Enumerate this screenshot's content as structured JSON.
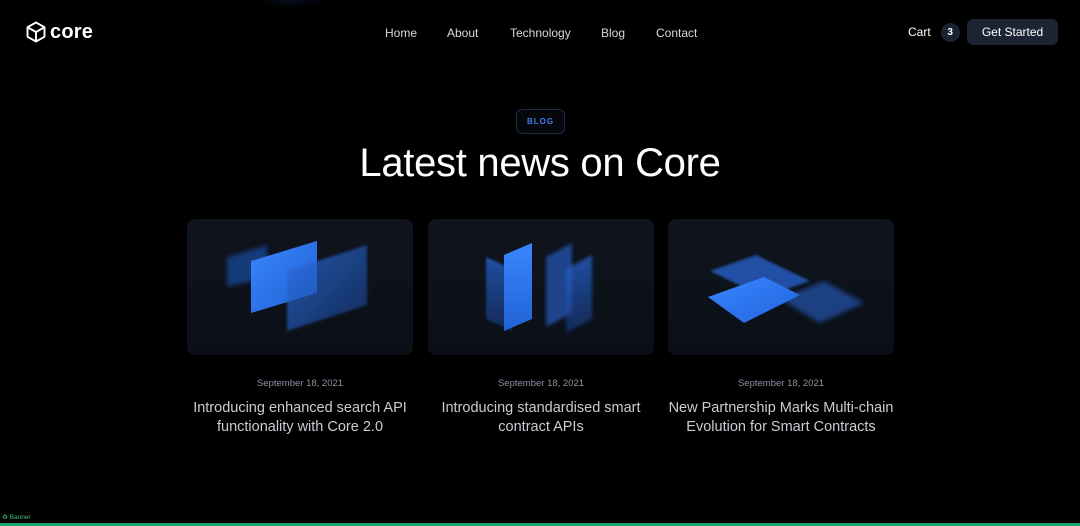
{
  "brand": {
    "name": "core",
    "logo_icon": "cube-icon"
  },
  "nav": {
    "items": [
      {
        "label": "Home"
      },
      {
        "label": "About"
      },
      {
        "label": "Technology"
      },
      {
        "label": "Blog"
      },
      {
        "label": "Contact"
      }
    ]
  },
  "cart": {
    "label": "Cart",
    "count": "3"
  },
  "cta": {
    "label": "Get Started"
  },
  "hero": {
    "badge": "BLOG",
    "title": "Latest news on Core"
  },
  "posts": [
    {
      "date": "September 18, 2021",
      "title": "Introducing enhanced search API functionality with Core 2.0",
      "illustration": "overlapping-panels"
    },
    {
      "date": "September 18, 2021",
      "title": "Introducing standardised smart contract APIs",
      "illustration": "vertical-panels"
    },
    {
      "date": "September 18, 2021",
      "title": "New Partnership Marks Multi-chain Evolution for Smart Contracts",
      "illustration": "stacked-planes"
    }
  ],
  "footer": {
    "banner_label": "Banner"
  },
  "colors": {
    "background": "#000000",
    "accent": "#2f7bf6",
    "button_bg": "#1c2333",
    "card_bg": "#0e131b",
    "badge_text": "#3f7fe8"
  }
}
